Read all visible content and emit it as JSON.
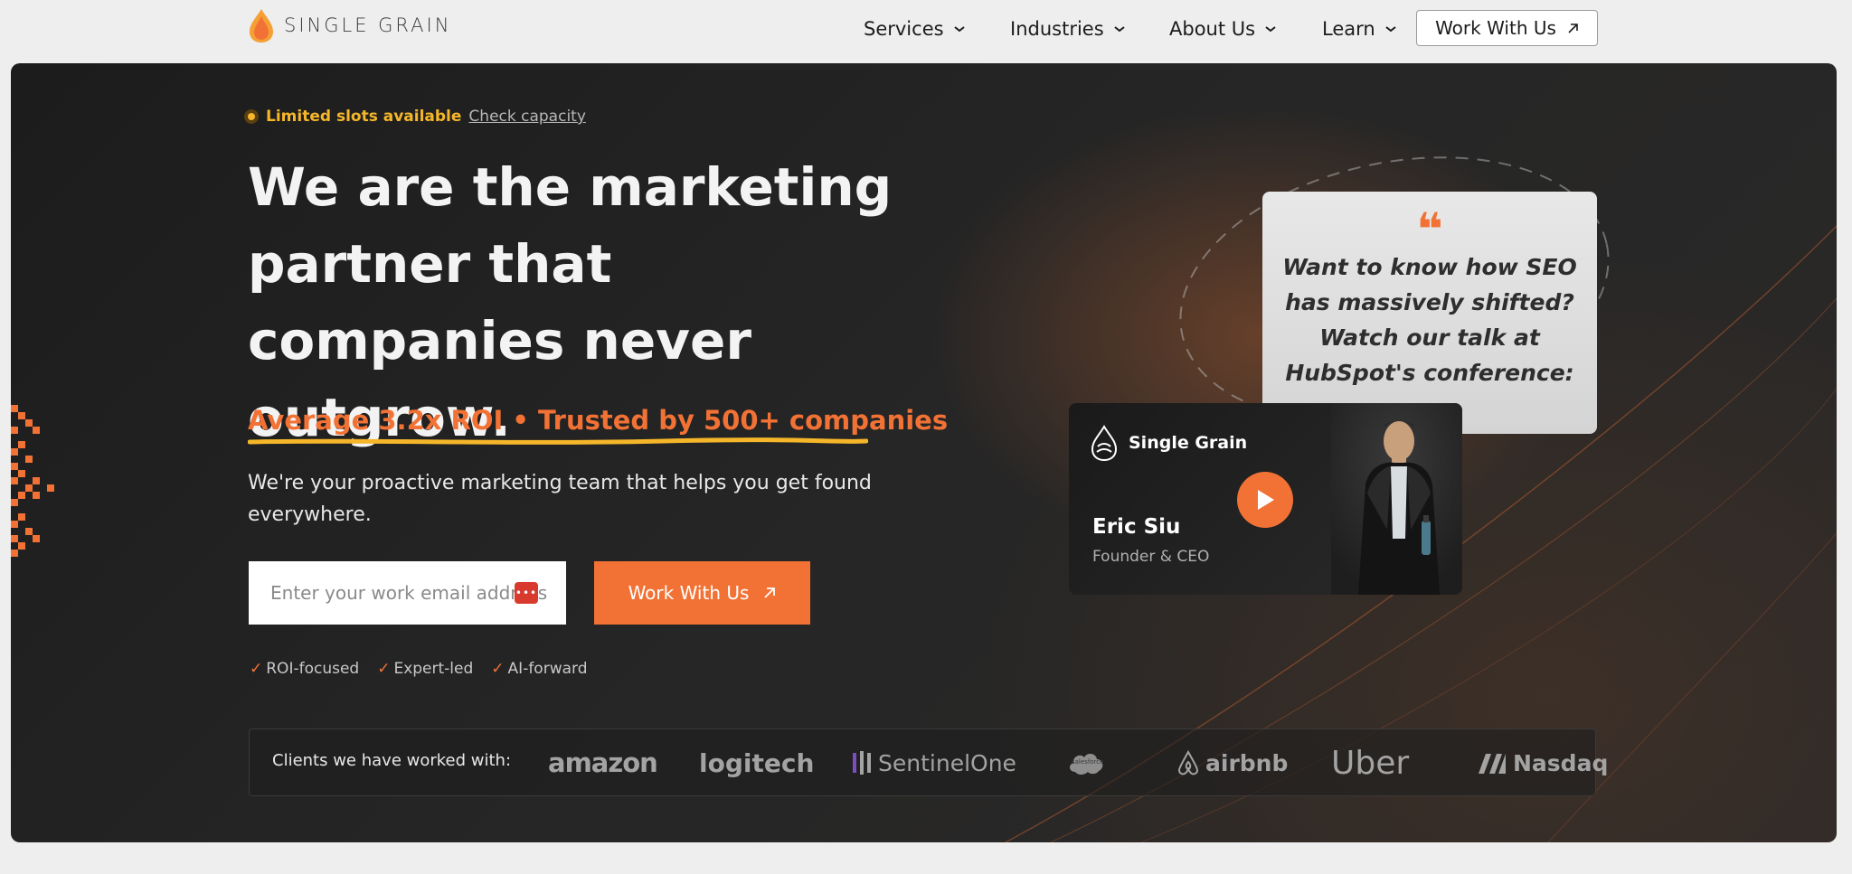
{
  "nav": {
    "brand": "SINGLE GRAIN",
    "items": [
      {
        "label": "Services"
      },
      {
        "label": "Industries"
      },
      {
        "label": "About Us"
      },
      {
        "label": "Learn"
      }
    ],
    "cta_label": "Work With Us"
  },
  "hero": {
    "slots_label": "Limited slots available",
    "slots_link": "Check capacity",
    "headline": "We are the marketing partner that companies never outgrow.",
    "roi": "Average 3.2x ROI • Trusted by 500+ companies",
    "subheadline": "We're your proactive marketing team that helps you get found everywhere.",
    "email_placeholder": "Enter your work email address",
    "cta_label": "Work With Us",
    "checks": [
      "ROI-focused",
      "Expert-led",
      "AI-forward"
    ],
    "clients_label": "Clients we have worked with:",
    "clients": [
      "amazon",
      "logitech",
      "SentinelOne",
      "salesforce",
      "airbnb",
      "Uber",
      "Nasdaq"
    ]
  },
  "testimonial": {
    "quote": "Want to know how SEO has massively shifted? Watch our talk at HubSpot's conference:",
    "video_brand": "Single Grain",
    "speaker_name": "Eric Siu",
    "speaker_role": "Founder & CEO"
  },
  "colors": {
    "accent": "#f27235",
    "highlight": "#f5b62a",
    "hero_bg": "#1f1f1f",
    "page_bg": "#eeeeee"
  }
}
